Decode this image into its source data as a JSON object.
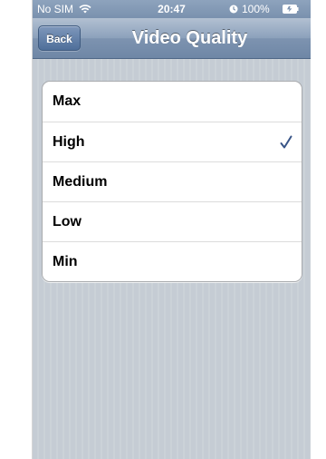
{
  "status_bar": {
    "carrier": "No SIM",
    "time": "20:47",
    "battery_percent": "100%",
    "icons": [
      "wifi-icon",
      "alarm-icon",
      "battery-icon"
    ]
  },
  "nav_bar": {
    "back_label": "Back",
    "title": "Video Quality"
  },
  "options": [
    {
      "label": "Max",
      "selected": false
    },
    {
      "label": "High",
      "selected": true
    },
    {
      "label": "Medium",
      "selected": false
    },
    {
      "label": "Low",
      "selected": false
    },
    {
      "label": "Min",
      "selected": false
    }
  ],
  "colors": {
    "checkmark": "#385487",
    "nav_bar": "#7d93b0",
    "background": "#c5ccd4"
  }
}
